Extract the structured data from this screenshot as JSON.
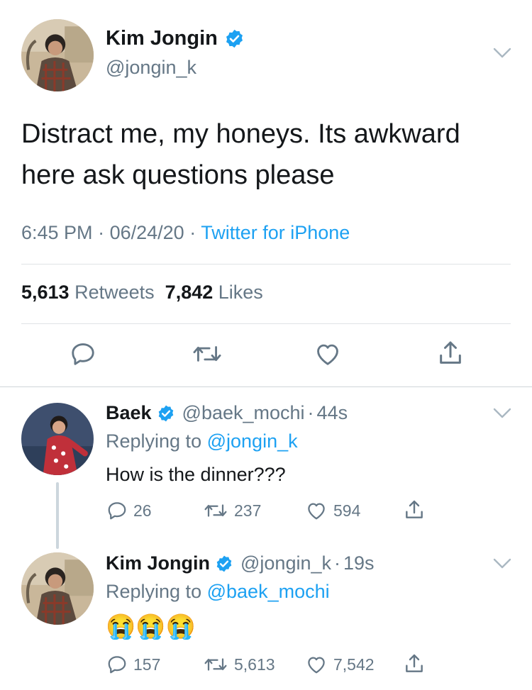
{
  "main_tweet": {
    "name": "Kim Jongin",
    "handle": "@jongin_k",
    "text": "Distract me, my honeys. Its awkward here ask questions please",
    "time": "6:45 PM",
    "date": "06/24/20",
    "source": "Twitter for iPhone",
    "retweets": "5,613",
    "retweets_label": "Retweets",
    "likes": "7,842",
    "likes_label": "Likes"
  },
  "reply_1": {
    "name": "Baek",
    "handle": "@baek_mochi",
    "age": "44s",
    "replying_prefix": "Replying to",
    "replying_to": "@jongin_k",
    "text": "How is the dinner???",
    "replies": "26",
    "retweets": "237",
    "likes": "594"
  },
  "reply_2": {
    "name": "Kim Jongin",
    "handle": "@jongin_k",
    "age": "19s",
    "replying_prefix": "Replying to",
    "replying_to": "@baek_mochi",
    "emoji_text": "😭😭😭",
    "replies": "157",
    "retweets": "5,613",
    "likes": "7,542"
  },
  "colors": {
    "accent": "#1da1f2",
    "secondary_text": "#657786",
    "primary_text": "#14171a",
    "divider": "#dfe3e6"
  },
  "icons": [
    "verified-icon",
    "chevron-down-icon",
    "reply-icon",
    "retweet-icon",
    "like-icon",
    "share-icon"
  ]
}
